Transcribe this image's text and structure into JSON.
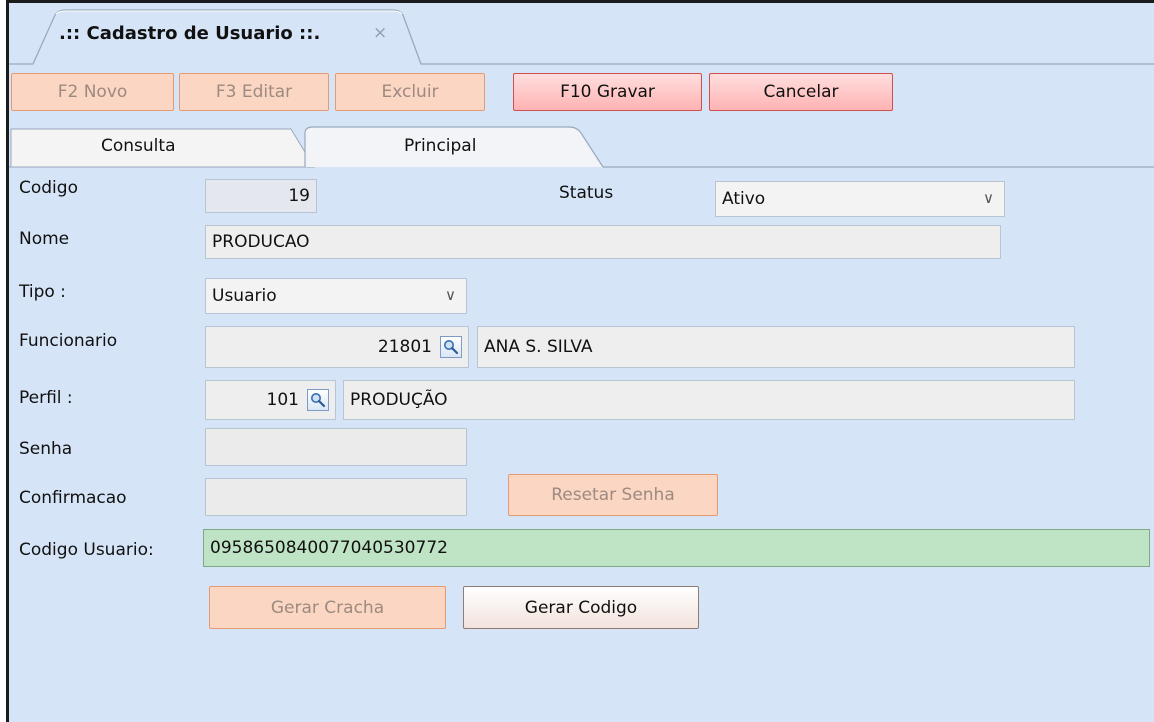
{
  "document_tab": {
    "title": ".:: Cadastro de Usuario ::.",
    "close_glyph": "×"
  },
  "toolbar": {
    "novo": "F2 Novo",
    "editar": "F3 Editar",
    "excluir": "Excluir",
    "gravar": "F10 Gravar",
    "cancelar": "Cancelar"
  },
  "tabs": {
    "consulta": "Consulta",
    "principal": "Principal"
  },
  "form": {
    "codigo": {
      "label": "Codigo",
      "value": "19"
    },
    "status": {
      "label": "Status",
      "value": "Ativo"
    },
    "nome": {
      "label": "Nome",
      "value": "PRODUCAO"
    },
    "tipo": {
      "label": "Tipo :",
      "value": "Usuario"
    },
    "funcionario": {
      "label": "Funcionario",
      "code": "21801",
      "name": "ANA S. SILVA"
    },
    "perfil": {
      "label": "Perfil :",
      "code": "101",
      "name": "PRODUÇÃO"
    },
    "senha": {
      "label": "Senha",
      "value": ""
    },
    "confirmacao": {
      "label": "Confirmacao",
      "value": ""
    },
    "resetar_senha": "Resetar Senha",
    "codigo_usuario": {
      "label": "Codigo Usuario:",
      "value": "0958650840077040530772"
    },
    "gerar_cracha": "Gerar Cracha",
    "gerar_codigo": "Gerar Codigo"
  },
  "icons": {
    "lookup": "magnifier-icon",
    "dropdown": "chevron-down-icon",
    "close": "close-icon"
  },
  "colors": {
    "background": "#d6e4f7",
    "disabled_button": "#fbd6c2",
    "primary_button": "#ffb3b3",
    "highlight_field": "#bfe3c5"
  }
}
